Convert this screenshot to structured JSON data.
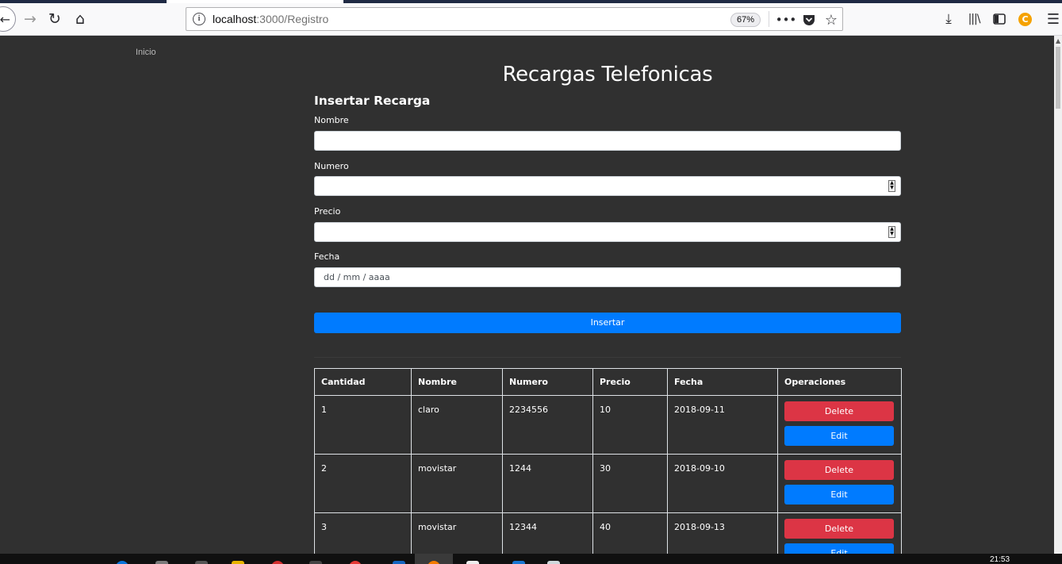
{
  "browser": {
    "url_host": "localhost",
    "url_path": ":3000/Registro",
    "zoom": "67%"
  },
  "nav": {
    "home_link": "Inicio"
  },
  "page": {
    "title": "Recargas Telefonicas",
    "form_title": "Insertar Recarga",
    "fields": {
      "nombre_label": "Nombre",
      "numero_label": "Numero",
      "precio_label": "Precio",
      "fecha_label": "Fecha",
      "fecha_placeholder": "dd / mm / aaaa"
    },
    "submit_label": "Insertar"
  },
  "table": {
    "headers": [
      "Cantidad",
      "Nombre",
      "Numero",
      "Precio",
      "Fecha",
      "Operaciones"
    ],
    "rows": [
      {
        "cantidad": "1",
        "nombre": "claro",
        "numero": "2234556",
        "precio": "10",
        "fecha": "2018-09-11"
      },
      {
        "cantidad": "2",
        "nombre": "movistar",
        "numero": "1244",
        "precio": "30",
        "fecha": "2018-09-10"
      },
      {
        "cantidad": "3",
        "nombre": "movistar",
        "numero": "12344",
        "precio": "40",
        "fecha": "2018-09-13"
      }
    ],
    "delete_label": "Delete",
    "edit_label": "Edit"
  },
  "taskbar": {
    "clock": "21:53"
  },
  "colors": {
    "background": "#303030",
    "primary": "#007bff",
    "danger": "#dc3545"
  }
}
